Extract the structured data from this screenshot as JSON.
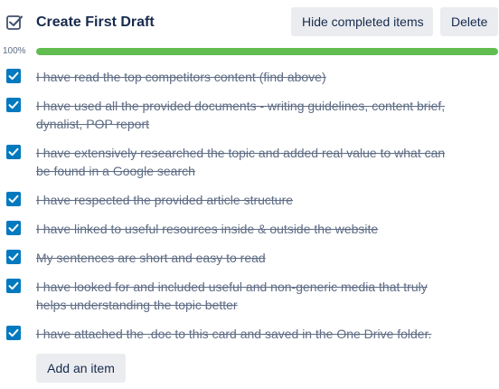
{
  "checklist": {
    "title": "Create First Draft",
    "hide_completed_label": "Hide completed items",
    "delete_label": "Delete",
    "progress_text": "100%",
    "progress_fraction": 1.0,
    "add_item_label": "Add an item",
    "items": [
      {
        "text": "I have read the top competitors content (find above)",
        "checked": true
      },
      {
        "text": "I have used all the provided documents - writing guidelines, content brief, dynalist, POP report",
        "checked": true
      },
      {
        "text": "I have extensively researched the topic and added real value to what can be found in a Google search",
        "checked": true
      },
      {
        "text": "I have respected the provided article structure",
        "checked": true
      },
      {
        "text": "I have linked to useful resources inside & outside the website",
        "checked": true
      },
      {
        "text": "My sentences are short and easy to read",
        "checked": true
      },
      {
        "text": "I have looked for and included useful and non-generic media that truly helps understanding the topic better",
        "checked": true
      },
      {
        "text": "I have attached the .doc to this card and saved in the One Drive folder.",
        "checked": true
      }
    ]
  },
  "colors": {
    "checkbox": "#0079bf",
    "progress_fill": "#61bd4f",
    "progress_track": "#dfe1e6",
    "button_bg": "#ebecf0",
    "completed_text": "#5e6c84"
  },
  "icons": {
    "header": "checklist-icon",
    "checkbox": "checkmark-icon"
  }
}
